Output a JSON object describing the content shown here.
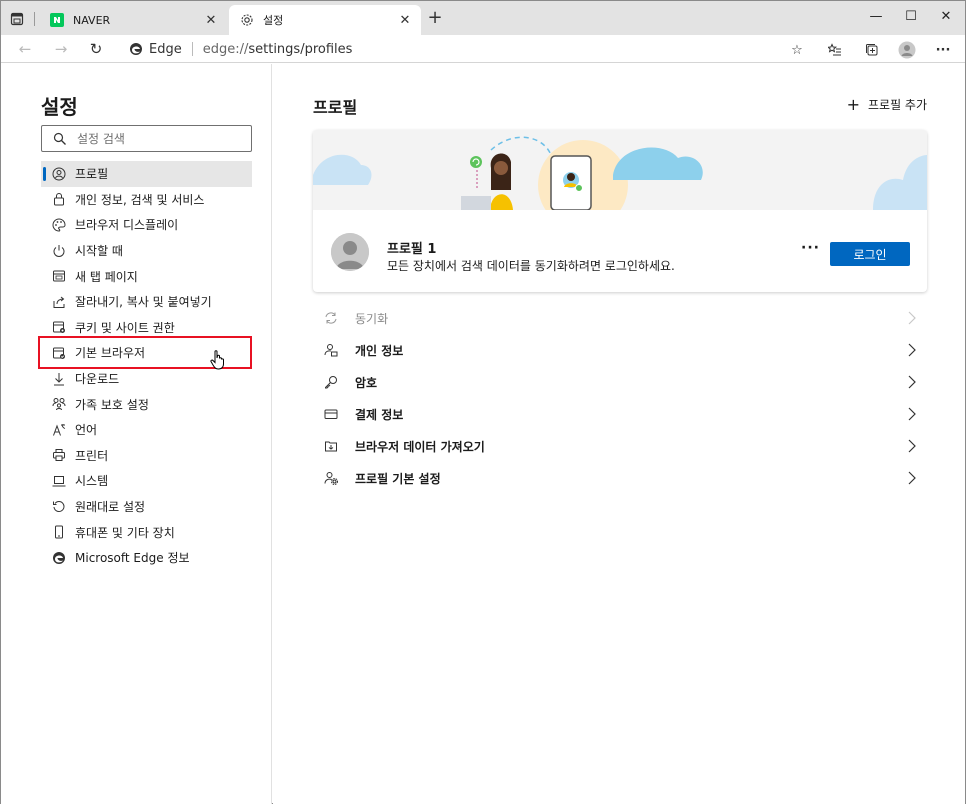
{
  "tabs": [
    {
      "title": "NAVER",
      "favicon": "naver-icon",
      "active": false
    },
    {
      "title": "설정",
      "favicon": "gear-icon",
      "active": true
    }
  ],
  "address": {
    "brand": "Edge",
    "url_scheme": "edge://",
    "url_path": "settings/profiles"
  },
  "sidebar": {
    "title": "설정",
    "search_placeholder": "설정 검색",
    "items": [
      {
        "label": "프로필",
        "icon": "profile-icon"
      },
      {
        "label": "개인 정보, 검색 및 서비스",
        "icon": "lock-icon"
      },
      {
        "label": "브라우저 디스플레이",
        "icon": "palette-icon"
      },
      {
        "label": "시작할 때",
        "icon": "power-icon"
      },
      {
        "label": "새 탭 페이지",
        "icon": "new-tab-icon"
      },
      {
        "label": "잘라내기, 복사 및 붙여넣기",
        "icon": "share-icon"
      },
      {
        "label": "쿠키 및 사이트 권한",
        "icon": "cookie-icon"
      },
      {
        "label": "기본 브라우저",
        "icon": "default-browser-icon"
      },
      {
        "label": "다운로드",
        "icon": "download-icon"
      },
      {
        "label": "가족 보호 설정",
        "icon": "family-icon"
      },
      {
        "label": "언어",
        "icon": "language-icon"
      },
      {
        "label": "프린터",
        "icon": "printer-icon"
      },
      {
        "label": "시스템",
        "icon": "laptop-icon"
      },
      {
        "label": "원래대로 설정",
        "icon": "reset-icon"
      },
      {
        "label": "휴대폰 및 기타 장치",
        "icon": "phone-icon"
      },
      {
        "label": "Microsoft Edge 정보",
        "icon": "edge-icon"
      }
    ]
  },
  "main": {
    "title": "프로필",
    "add_profile": "프로필 추가",
    "profile": {
      "name": "프로필 1",
      "description": "모든 장치에서 검색 데이터를 동기화하려면 로그인하세요.",
      "more": "···",
      "login_label": "로그인"
    },
    "rows": [
      {
        "label": "동기화",
        "icon": "sync-icon",
        "disabled": true
      },
      {
        "label": "개인 정보",
        "icon": "personal-info-icon",
        "disabled": false
      },
      {
        "label": "암호",
        "icon": "key-icon",
        "disabled": false
      },
      {
        "label": "결제 정보",
        "icon": "card-icon",
        "disabled": false
      },
      {
        "label": "브라우저 데이터 가져오기",
        "icon": "import-icon",
        "disabled": false
      },
      {
        "label": "프로필 기본 설정",
        "icon": "profile-settings-icon",
        "disabled": false
      }
    ]
  },
  "colors": {
    "accent": "#0067c0",
    "highlight": "#e81123",
    "naver_green": "#03c75a"
  }
}
